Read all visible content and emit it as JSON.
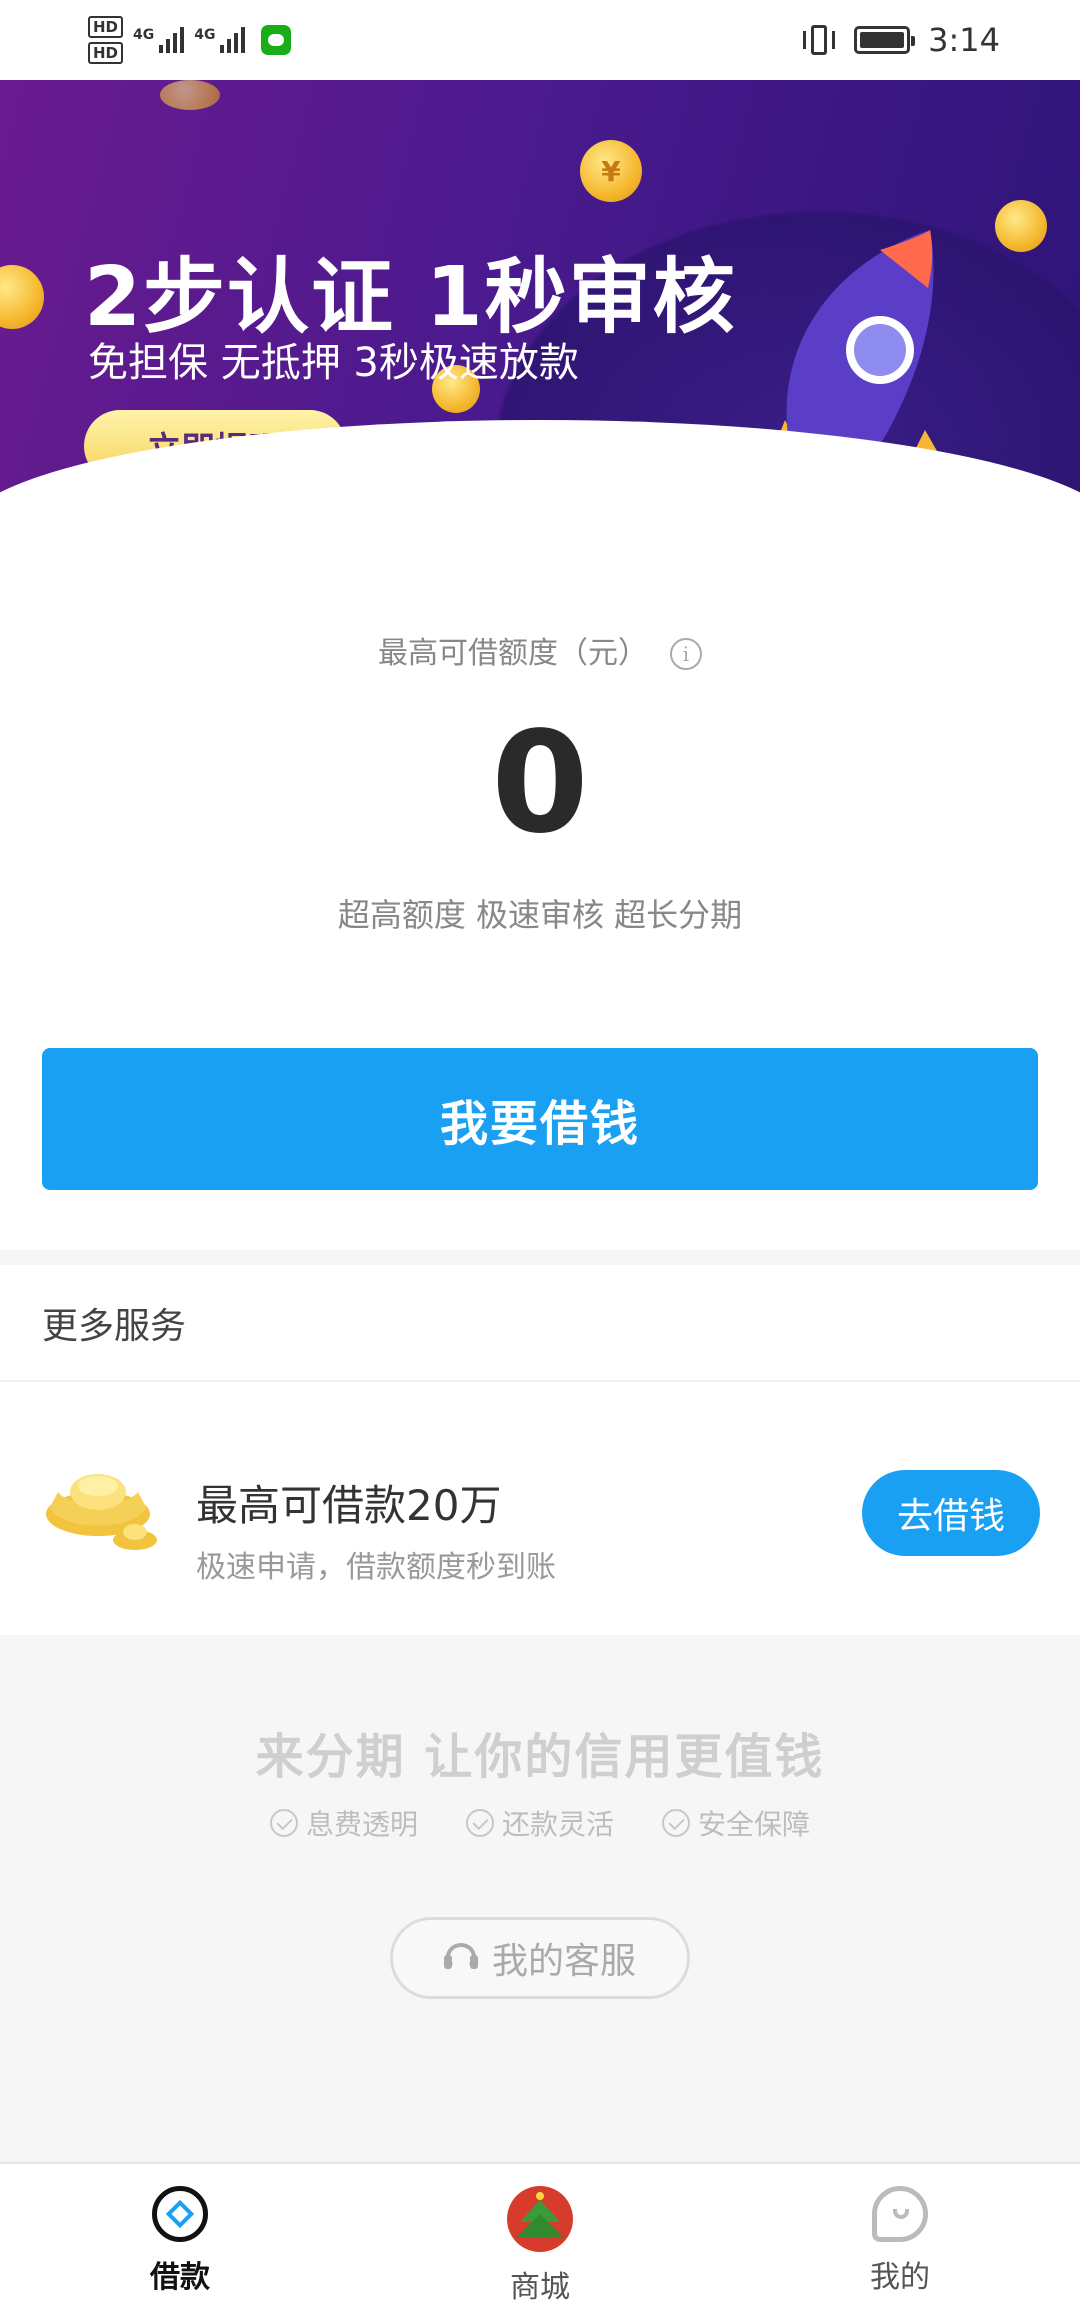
{
  "status_bar": {
    "hd1": "HD",
    "hd2": "HD",
    "net1": "4G",
    "net2": "4G",
    "time": "3:14"
  },
  "banner": {
    "headline": "2步认证 1秒审核",
    "subline": "免担保 无抵押 3秒极速放款",
    "button": "立即提现"
  },
  "limit": {
    "label": "最高可借额度（元）",
    "amount": "0",
    "tagline": "超高额度 极速审核 超长分期",
    "borrow_button": "我要借钱"
  },
  "services": {
    "title": "更多服务",
    "item": {
      "title": "最高可借款20万",
      "desc": "极速申请，借款额度秒到账",
      "button": "去借钱"
    }
  },
  "promo": {
    "title": "来分期 让你的信用更值钱",
    "features": [
      "息费透明",
      "还款灵活",
      "安全保障"
    ],
    "service_button": "我的客服"
  },
  "bottom_nav": {
    "items": [
      {
        "label": "借款",
        "icon": "loan-icon",
        "active": true
      },
      {
        "label": "商城",
        "icon": "mall-tree-icon",
        "active": false
      },
      {
        "label": "我的",
        "icon": "profile-icon",
        "active": false
      }
    ]
  },
  "colors": {
    "accent": "#1aa0f3",
    "banner_purple": "#4a1a8e",
    "gold": "#f6d25a"
  }
}
